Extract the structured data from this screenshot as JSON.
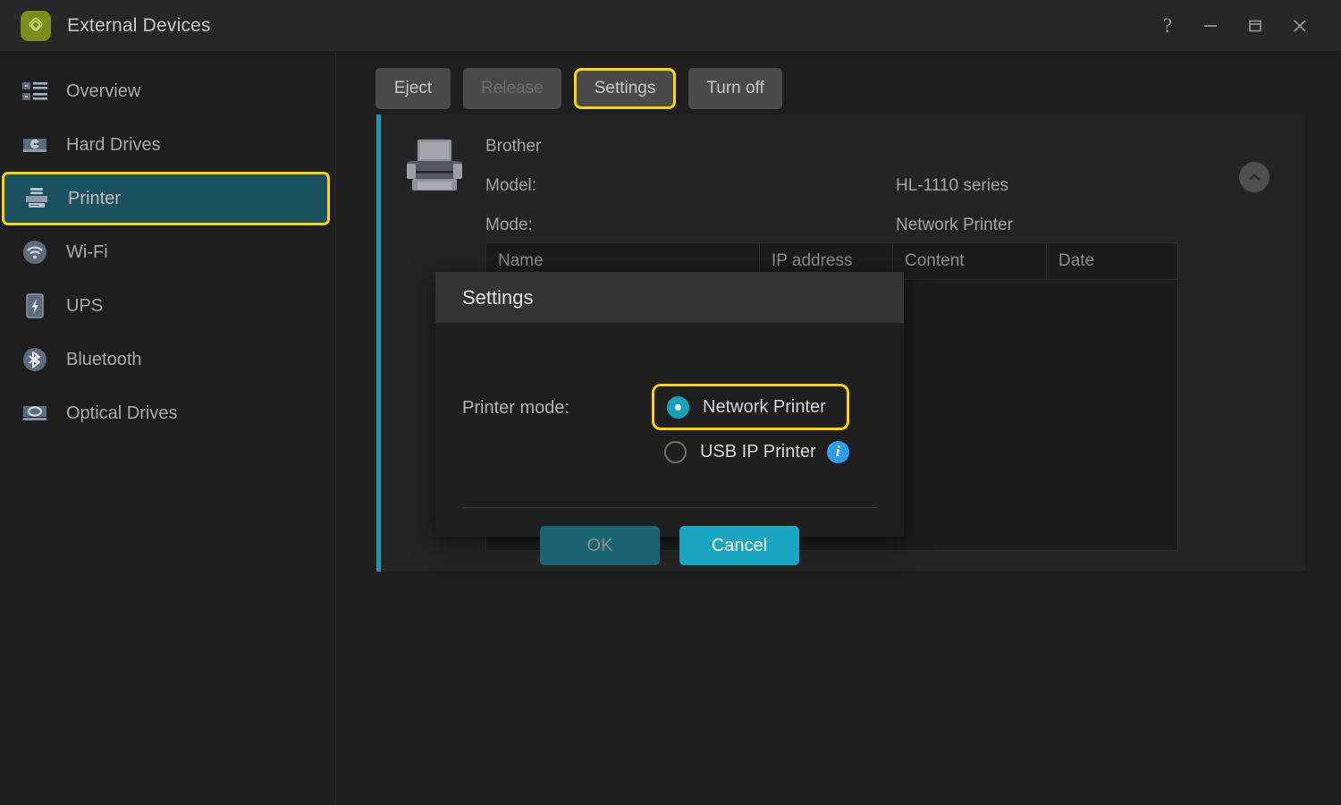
{
  "window": {
    "title": "External Devices",
    "app_icon": "app-logo-icon",
    "controls": [
      {
        "name": "help-button",
        "glyph": "?"
      },
      {
        "name": "minimize-button",
        "glyph": "—"
      },
      {
        "name": "maximize-button",
        "glyph": "❐"
      },
      {
        "name": "close-button",
        "glyph": "✕"
      }
    ]
  },
  "sidebar": {
    "items": [
      {
        "label": "Overview",
        "icon": "list-overview-icon",
        "selected": false
      },
      {
        "label": "Hard Drives",
        "icon": "hard-drive-icon",
        "selected": false
      },
      {
        "label": "Printer",
        "icon": "printer-icon",
        "selected": true
      },
      {
        "label": "Wi-Fi",
        "icon": "wifi-icon",
        "selected": false
      },
      {
        "label": "UPS",
        "icon": "ups-battery-icon",
        "selected": false
      },
      {
        "label": "Bluetooth",
        "icon": "bluetooth-icon",
        "selected": false
      },
      {
        "label": "Optical Drives",
        "icon": "optical-drive-icon",
        "selected": false
      }
    ]
  },
  "toolbar": {
    "buttons": [
      {
        "label": "Eject",
        "state": "enabled"
      },
      {
        "label": "Release",
        "state": "disabled"
      },
      {
        "label": "Settings",
        "state": "highlighted"
      },
      {
        "label": "Turn off",
        "state": "enabled"
      }
    ]
  },
  "device": {
    "brand": "Brother",
    "fields": [
      {
        "label": "Model:",
        "value": "HL-1110 series"
      },
      {
        "label": "Mode:",
        "value": "Network Printer"
      }
    ],
    "collapse_icon": "chevron-up-icon",
    "photo_icon": "printer-photo-icon"
  },
  "jobs_table": {
    "columns": [
      "Name",
      "IP address",
      "Content",
      "Date"
    ],
    "rows": []
  },
  "dialog": {
    "title": "Settings",
    "field_label": "Printer mode:",
    "options": [
      {
        "label": "Network Printer",
        "checked": true,
        "highlighted": true,
        "info": false
      },
      {
        "label": "USB IP Printer",
        "checked": false,
        "highlighted": false,
        "info": true,
        "info_glyph": "i"
      }
    ],
    "ok_label": "OK",
    "cancel_label": "Cancel"
  },
  "colors": {
    "accent_teal": "#1a96ad",
    "highlight_yellow": "#ffd400",
    "selected_nav_bg": "#1a525f",
    "cancel_button": "#1aa5c0",
    "ok_button": "#1a6572",
    "info_blue": "#2f9ee8",
    "app_icon_green": "#7c8c1e"
  }
}
